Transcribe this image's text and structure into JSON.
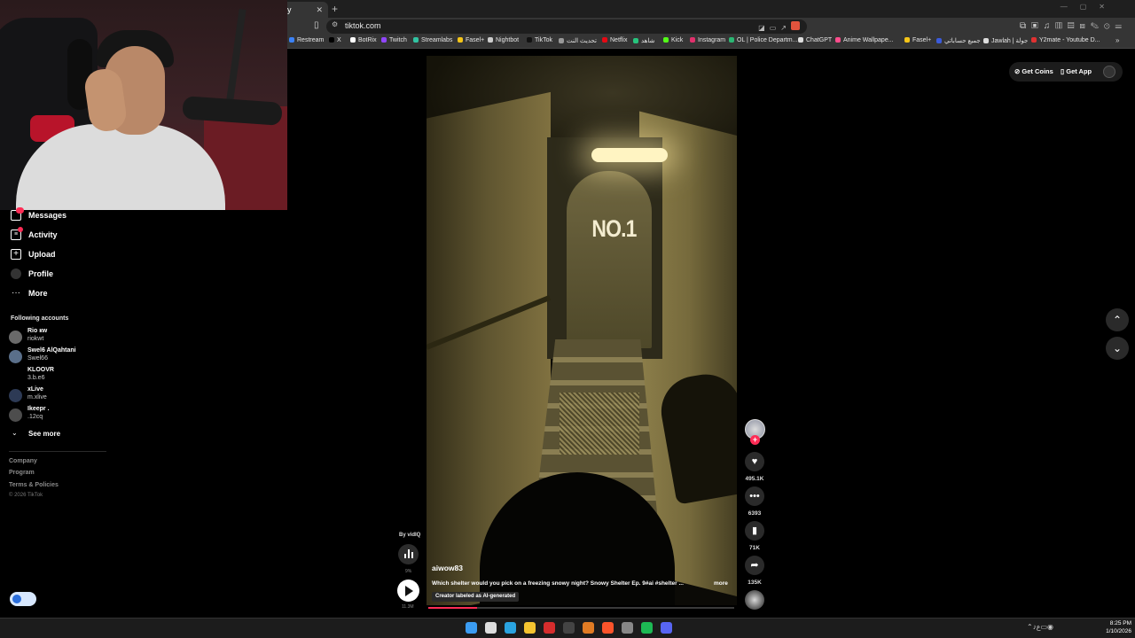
{
  "browser": {
    "tab_title": "y",
    "url": "tiktok.com",
    "bookmarks": [
      {
        "label": "Restream",
        "color": "#3b82f6"
      },
      {
        "label": "X",
        "color": "#000000"
      },
      {
        "label": "BotRix",
        "color": "#ffffff"
      },
      {
        "label": "Twitch",
        "color": "#9146ff"
      },
      {
        "label": "Streamlabs",
        "color": "#31c3a2"
      },
      {
        "label": "Fasel+",
        "color": "#f5c518"
      },
      {
        "label": "Nightbot",
        "color": "#cccccc"
      },
      {
        "label": "TikTok",
        "color": "#111111"
      },
      {
        "label": "تحديث النت",
        "color": "#999999"
      },
      {
        "label": "Netflix",
        "color": "#e50914"
      },
      {
        "label": "شاهد",
        "color": "#27c47d"
      },
      {
        "label": "Kick",
        "color": "#53fc18"
      },
      {
        "label": "Instagram",
        "color": "#e1306c"
      },
      {
        "label": "OL | Police Departm...",
        "color": "#2bb673"
      },
      {
        "label": "ChatGPT",
        "color": "#dddddd"
      },
      {
        "label": "Anime Wallpape...",
        "color": "#ff4d8d"
      },
      {
        "label": "Fasel+",
        "color": "#f5c518"
      },
      {
        "label": "جميع حساباتي",
        "color": "#3b5bdb"
      },
      {
        "label": "Jawlah | جولة",
        "color": "#dddddd"
      },
      {
        "label": "Y2mate - Youtube D...",
        "color": "#e03131"
      }
    ]
  },
  "sidebar": {
    "nav": [
      {
        "label": "Messages",
        "icon": "message-icon"
      },
      {
        "label": "Activity",
        "icon": "activity-icon"
      },
      {
        "label": "Upload",
        "icon": "upload-icon"
      },
      {
        "label": "Profile",
        "icon": "profile-icon"
      },
      {
        "label": "More",
        "icon": "more-icon"
      }
    ],
    "following_title": "Following accounts",
    "accounts": [
      {
        "name": "Rio кw",
        "handle": "riokwt"
      },
      {
        "name": "Swel6 AlQahtani",
        "handle": "Swel66"
      },
      {
        "name": "KLOOVR",
        "handle": "3.b.e6"
      },
      {
        "name": "xLive",
        "handle": "m.xlive"
      },
      {
        "name": "Ikeepr .",
        "handle": ".12cq"
      }
    ],
    "see_more": "See more",
    "footer": [
      "Company",
      "Program",
      "Terms & Policies"
    ],
    "copyright": "© 2026 TikTok"
  },
  "header": {
    "get_coins": "Get Coins",
    "get_app": "Get App"
  },
  "video": {
    "door_text": "NO.1",
    "by_label": "By vidIQ",
    "stats_percent": "9%",
    "views": "11.3M",
    "username": "aiwow83",
    "caption": "Which shelter would you pick on a freezing snowy night? Snowy Shelter Ep. 9#ai #shelter ...",
    "more": "more",
    "ai_label": "Creator labeled as AI-generated",
    "progress": 0.16
  },
  "actions": {
    "likes": "495.1K",
    "comments": "6393",
    "saves": "71K",
    "shares": "135K"
  },
  "taskbar": {
    "icons": [
      {
        "name": "windows-start-icon",
        "color": "#3b9cf2"
      },
      {
        "name": "calendar-icon",
        "color": "#dddddd"
      },
      {
        "name": "telegram-icon",
        "color": "#2aa3e0"
      },
      {
        "name": "file-explorer-icon",
        "color": "#f4c430"
      },
      {
        "name": "app-red-icon",
        "color": "#d62d2d"
      },
      {
        "name": "app-dark-icon",
        "color": "#444444"
      },
      {
        "name": "app-orange-icon",
        "color": "#e07b24"
      },
      {
        "name": "brave-icon",
        "color": "#fb542b"
      },
      {
        "name": "obs-icon",
        "color": "#888888"
      },
      {
        "name": "spotify-icon",
        "color": "#1db954"
      },
      {
        "name": "discord-icon",
        "color": "#5865f2"
      }
    ],
    "time": "8:25 PM",
    "date": "1/10/2026"
  }
}
